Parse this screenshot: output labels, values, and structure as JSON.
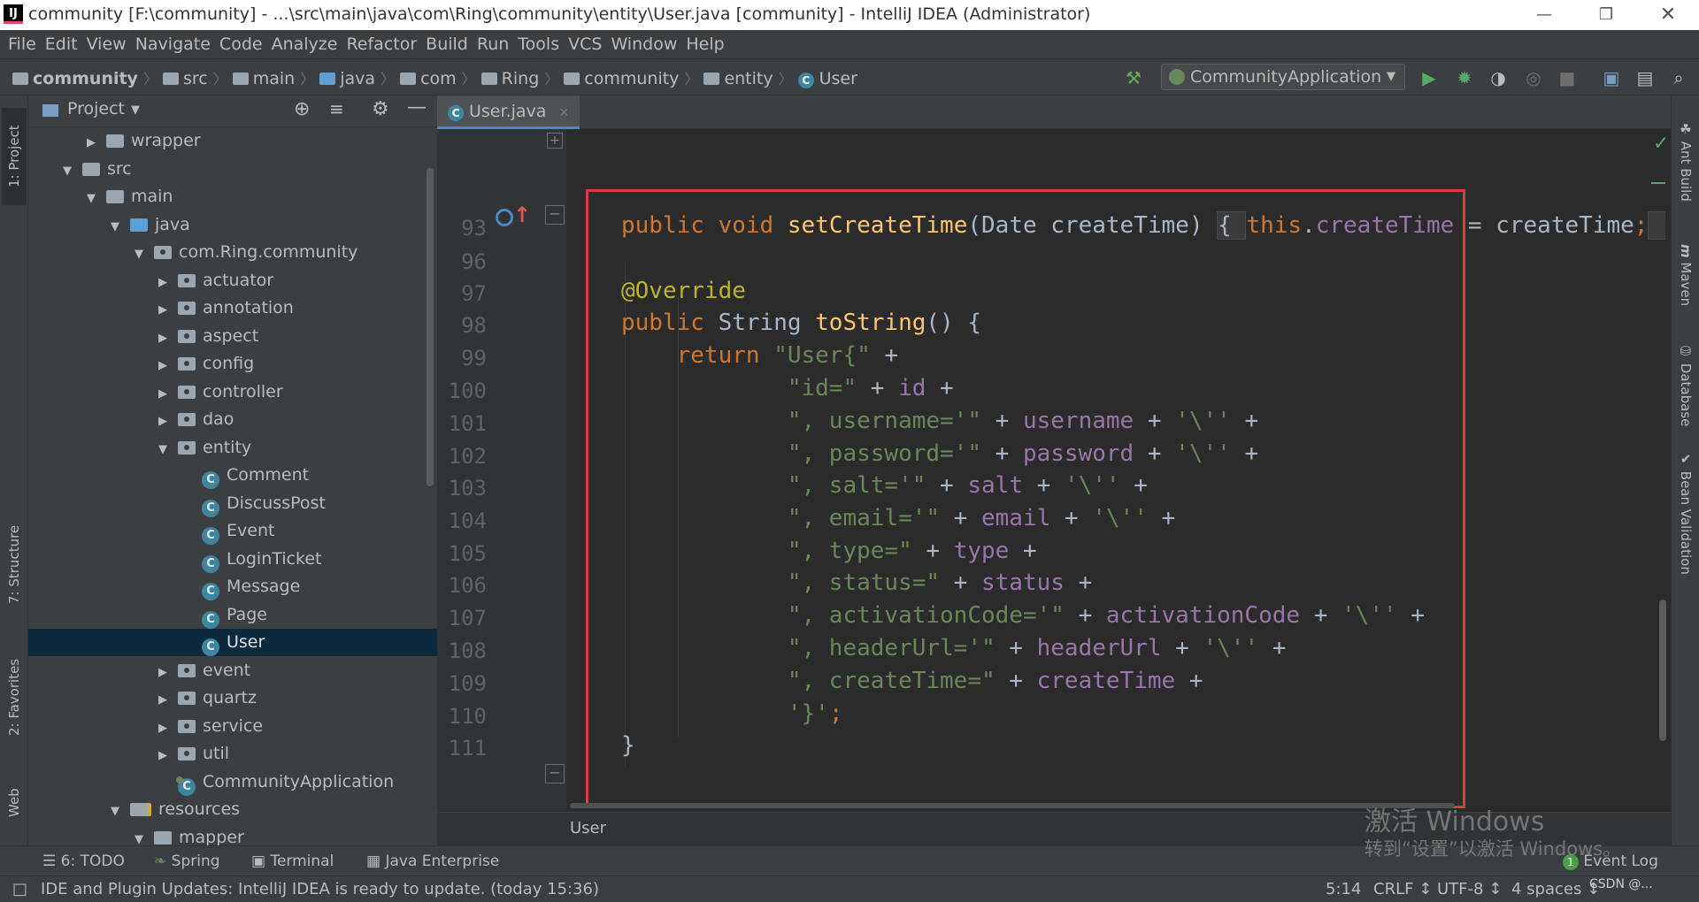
{
  "window": {
    "title": "community [F:\\community] - ...\\src\\main\\java\\com\\Ring\\community\\entity\\User.java [community] - IntelliJ IDEA (Administrator)",
    "logo": "IJ",
    "controls": [
      "minimize-icon",
      "restore-icon",
      "close-icon"
    ]
  },
  "menu": [
    "File",
    "Edit",
    "View",
    "Navigate",
    "Code",
    "Analyze",
    "Refactor",
    "Build",
    "Run",
    "Tools",
    "VCS",
    "Window",
    "Help"
  ],
  "navbar": {
    "breadcrumbs": [
      "community",
      "src",
      "main",
      "java",
      "com",
      "Ring",
      "community",
      "entity",
      "User"
    ],
    "run_config": "CommunityApplication"
  },
  "left_strip": {
    "tabs": [
      "1: Project",
      "7: Structure",
      "2: Favorites",
      "Web"
    ]
  },
  "project": {
    "header_label": "Project",
    "tree": [
      {
        "label": "wrapper",
        "type": "folder",
        "level": 2,
        "arrow": "▶"
      },
      {
        "label": "src",
        "type": "folder",
        "level": 1,
        "arrow": "▼"
      },
      {
        "label": "main",
        "type": "folder",
        "level": 2,
        "arrow": "▼"
      },
      {
        "label": "java",
        "type": "folder-blue",
        "level": 3,
        "arrow": "▼"
      },
      {
        "label": "com.Ring.community",
        "type": "package",
        "level": 4,
        "arrow": "▼"
      },
      {
        "label": "actuator",
        "type": "package",
        "level": 5,
        "arrow": "▶"
      },
      {
        "label": "annotation",
        "type": "package",
        "level": 5,
        "arrow": "▶"
      },
      {
        "label": "aspect",
        "type": "package",
        "level": 5,
        "arrow": "▶"
      },
      {
        "label": "config",
        "type": "package",
        "level": 5,
        "arrow": "▶"
      },
      {
        "label": "controller",
        "type": "package",
        "level": 5,
        "arrow": "▶"
      },
      {
        "label": "dao",
        "type": "package",
        "level": 5,
        "arrow": "▶"
      },
      {
        "label": "entity",
        "type": "package",
        "level": 5,
        "arrow": "▼"
      },
      {
        "label": "Comment",
        "type": "class",
        "level": 6,
        "arrow": ""
      },
      {
        "label": "DiscussPost",
        "type": "class",
        "level": 6,
        "arrow": ""
      },
      {
        "label": "Event",
        "type": "class",
        "level": 6,
        "arrow": ""
      },
      {
        "label": "LoginTicket",
        "type": "class",
        "level": 6,
        "arrow": ""
      },
      {
        "label": "Message",
        "type": "class",
        "level": 6,
        "arrow": ""
      },
      {
        "label": "Page",
        "type": "class",
        "level": 6,
        "arrow": ""
      },
      {
        "label": "User",
        "type": "class",
        "level": 6,
        "arrow": "",
        "selected": true
      },
      {
        "label": "event",
        "type": "package",
        "level": 5,
        "arrow": "▶"
      },
      {
        "label": "quartz",
        "type": "package",
        "level": 5,
        "arrow": "▶"
      },
      {
        "label": "service",
        "type": "package",
        "level": 5,
        "arrow": "▶"
      },
      {
        "label": "util",
        "type": "package",
        "level": 5,
        "arrow": "▶"
      },
      {
        "label": "CommunityApplication",
        "type": "app",
        "level": 5,
        "arrow": ""
      },
      {
        "label": "resources",
        "type": "folder-res",
        "level": 3,
        "arrow": "▼"
      },
      {
        "label": "mapper",
        "type": "folder",
        "level": 4,
        "arrow": "▼"
      }
    ]
  },
  "editor": {
    "tab_label": "User.java",
    "breadcrumb": "User",
    "lines": [
      {
        "num": "93",
        "tokens": [
          [
            "kw",
            "public "
          ],
          [
            "kw",
            "void "
          ],
          [
            "fn",
            "setCreateTime"
          ],
          [
            "plain",
            "(Date createTime) "
          ],
          [
            "fold",
            "{ "
          ],
          [
            "kw",
            "this"
          ],
          [
            "plain",
            "."
          ],
          [
            "fld",
            "createTime"
          ],
          [
            "plain",
            " = createTime"
          ],
          [
            "kw",
            ";"
          ],
          [
            "fold",
            " }"
          ]
        ]
      },
      {
        "num": "96",
        "tokens": []
      },
      {
        "num": "97",
        "tokens": [
          [
            "ann",
            "@Override"
          ]
        ]
      },
      {
        "num": "98",
        "tokens": [
          [
            "kw",
            "public "
          ],
          [
            "plain",
            "String "
          ],
          [
            "fn",
            "toString"
          ],
          [
            "plain",
            "() {"
          ]
        ]
      },
      {
        "num": "99",
        "tokens": [
          [
            "plain",
            "    "
          ],
          [
            "kw",
            "return "
          ],
          [
            "str",
            "\"User{\""
          ],
          [
            "plain",
            " +"
          ]
        ]
      },
      {
        "num": "100",
        "tokens": [
          [
            "plain",
            "            "
          ],
          [
            "str",
            "\"id=\""
          ],
          [
            "plain",
            " + "
          ],
          [
            "fld",
            "id"
          ],
          [
            "plain",
            " +"
          ]
        ]
      },
      {
        "num": "101",
        "tokens": [
          [
            "plain",
            "            "
          ],
          [
            "str",
            "\", username='\""
          ],
          [
            "plain",
            " + "
          ],
          [
            "fld",
            "username"
          ],
          [
            "plain",
            " + "
          ],
          [
            "str",
            "'\\''"
          ],
          [
            "plain",
            " +"
          ]
        ]
      },
      {
        "num": "102",
        "tokens": [
          [
            "plain",
            "            "
          ],
          [
            "str",
            "\", password='\""
          ],
          [
            "plain",
            " + "
          ],
          [
            "fld",
            "password"
          ],
          [
            "plain",
            " + "
          ],
          [
            "str",
            "'\\''"
          ],
          [
            "plain",
            " +"
          ]
        ]
      },
      {
        "num": "103",
        "tokens": [
          [
            "plain",
            "            "
          ],
          [
            "str",
            "\", salt='\""
          ],
          [
            "plain",
            " + "
          ],
          [
            "fld",
            "salt"
          ],
          [
            "plain",
            " + "
          ],
          [
            "str",
            "'\\''"
          ],
          [
            "plain",
            " +"
          ]
        ]
      },
      {
        "num": "104",
        "tokens": [
          [
            "plain",
            "            "
          ],
          [
            "str",
            "\", email='\""
          ],
          [
            "plain",
            " + "
          ],
          [
            "fld",
            "email"
          ],
          [
            "plain",
            " + "
          ],
          [
            "str",
            "'\\''"
          ],
          [
            "plain",
            " +"
          ]
        ]
      },
      {
        "num": "105",
        "tokens": [
          [
            "plain",
            "            "
          ],
          [
            "str",
            "\", type=\""
          ],
          [
            "plain",
            " + "
          ],
          [
            "fld",
            "type"
          ],
          [
            "plain",
            " +"
          ]
        ]
      },
      {
        "num": "106",
        "tokens": [
          [
            "plain",
            "            "
          ],
          [
            "str",
            "\", status=\""
          ],
          [
            "plain",
            " + "
          ],
          [
            "fld",
            "status"
          ],
          [
            "plain",
            " +"
          ]
        ]
      },
      {
        "num": "107",
        "tokens": [
          [
            "plain",
            "            "
          ],
          [
            "str",
            "\", activationCode='\""
          ],
          [
            "plain",
            " + "
          ],
          [
            "fld",
            "activationCode"
          ],
          [
            "plain",
            " + "
          ],
          [
            "str",
            "'\\''"
          ],
          [
            "plain",
            " +"
          ]
        ]
      },
      {
        "num": "108",
        "tokens": [
          [
            "plain",
            "            "
          ],
          [
            "str",
            "\", headerUrl='\""
          ],
          [
            "plain",
            " + "
          ],
          [
            "fld",
            "headerUrl"
          ],
          [
            "plain",
            " + "
          ],
          [
            "str",
            "'\\''"
          ],
          [
            "plain",
            " +"
          ]
        ]
      },
      {
        "num": "109",
        "tokens": [
          [
            "plain",
            "            "
          ],
          [
            "str",
            "\", createTime=\""
          ],
          [
            "plain",
            " + "
          ],
          [
            "fld",
            "createTime"
          ],
          [
            "plain",
            " +"
          ]
        ]
      },
      {
        "num": "110",
        "tokens": [
          [
            "plain",
            "            "
          ],
          [
            "str",
            "'}'"
          ],
          [
            "kw",
            ";"
          ]
        ]
      },
      {
        "num": "111",
        "tokens": [
          [
            "plain",
            "}"
          ]
        ]
      }
    ]
  },
  "right_strip": {
    "tabs": [
      "Ant Build",
      "Maven",
      "Database",
      "Bean Validation"
    ]
  },
  "bottom_tools": [
    "6: TODO",
    "Spring",
    "Terminal",
    "Java Enterprise"
  ],
  "event_log": {
    "count": "1",
    "label": "Event Log"
  },
  "status": {
    "message": "IDE and Plugin Updates: IntelliJ IDEA is ready to update. (today 15:36)",
    "position": "5:14",
    "line_sep": "CRLF",
    "encoding": "UTF-8",
    "indent": "4 spaces"
  },
  "watermark": {
    "line1": "激活 Windows",
    "line2": "转到“设置”以激活 Windows。",
    "csdn": "CSDN @..."
  },
  "colors": {
    "keyword": "#cc7832",
    "function": "#ffc66d",
    "field": "#9876aa",
    "string": "#6a8759",
    "annotation": "#bbb529",
    "highlight_box": "#e03c3c",
    "selection": "#0d293e"
  }
}
